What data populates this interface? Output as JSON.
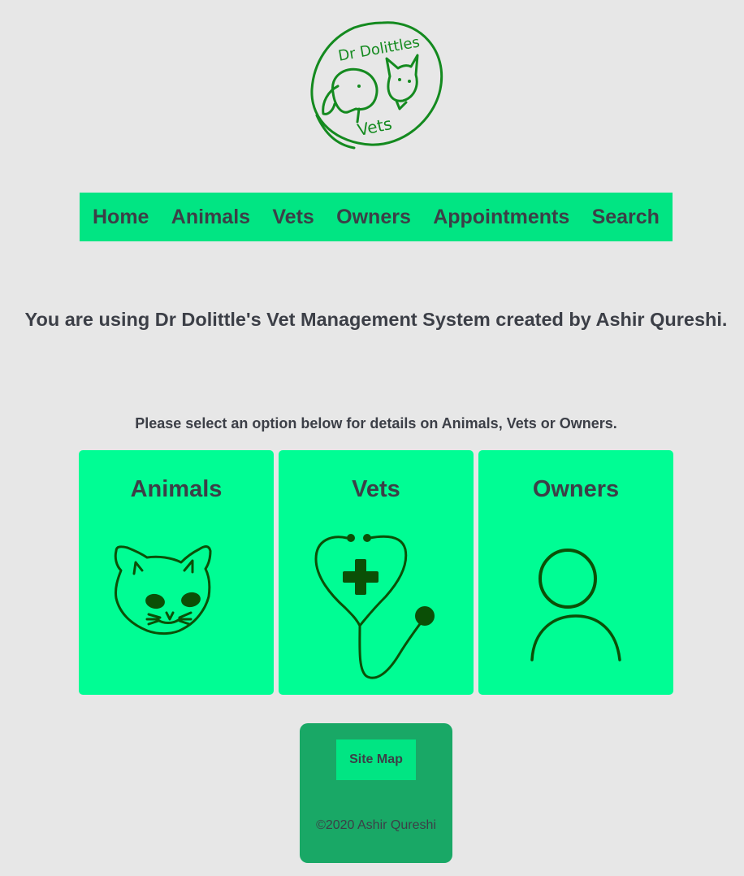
{
  "logo": {
    "text_line1": "Dr Dolittles",
    "text_line2": "Vets",
    "color": "#148a1f"
  },
  "nav": {
    "items": [
      "Home",
      "Animals",
      "Vets",
      "Owners",
      "Appointments",
      "Search"
    ],
    "background": "#01e583"
  },
  "intro": {
    "headline": "You are using Dr Dolittle's Vet Management System created by Ashir Qureshi.",
    "instruction": "Please select an option below for details on Animals, Vets or Owners."
  },
  "cards": [
    {
      "title": "Animals",
      "icon": "cat-icon"
    },
    {
      "title": "Vets",
      "icon": "stethoscope-icon"
    },
    {
      "title": "Owners",
      "icon": "person-icon"
    }
  ],
  "footer": {
    "sitemap_label": "Site Map",
    "copyright": "©2020 Ashir Qureshi"
  },
  "colors": {
    "page_bg": "#e7e7e7",
    "card_bg": "#00fd94",
    "footer_bg": "#19a866",
    "text": "#3c3f47",
    "icon": "#0b4f06"
  }
}
